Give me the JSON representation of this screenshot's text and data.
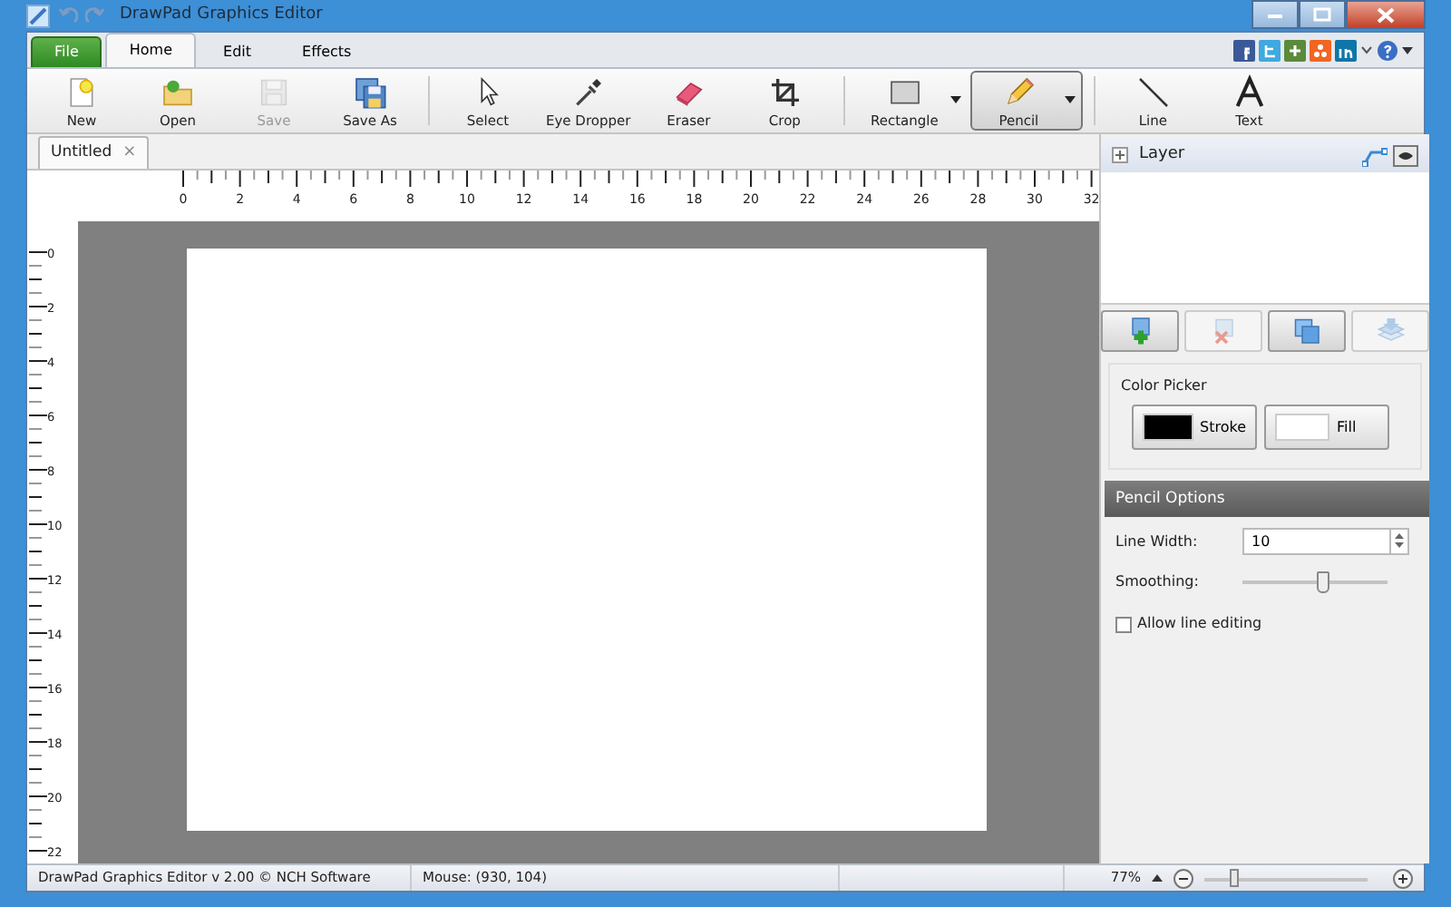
{
  "window": {
    "title": "DrawPad Graphics Editor"
  },
  "menu_tabs": [
    {
      "label": "File",
      "kind": "file",
      "selected": false
    },
    {
      "label": "Home",
      "kind": "tab",
      "selected": true
    },
    {
      "label": "Edit",
      "kind": "tab",
      "selected": false
    },
    {
      "label": "Effects",
      "kind": "tab",
      "selected": false
    }
  ],
  "toolbar": {
    "groups": [
      [
        {
          "label": "New",
          "kind": "new",
          "disabled": false,
          "selected": false,
          "dropdown": false
        },
        {
          "label": "Open",
          "kind": "open",
          "disabled": false,
          "selected": false,
          "dropdown": false
        },
        {
          "label": "Save",
          "kind": "save",
          "disabled": true,
          "selected": false,
          "dropdown": false
        },
        {
          "label": "Save As",
          "kind": "saveas",
          "disabled": false,
          "selected": false,
          "dropdown": false
        }
      ],
      [
        {
          "label": "Select",
          "kind": "select",
          "disabled": false,
          "selected": false,
          "dropdown": false
        },
        {
          "label": "Eye Dropper",
          "kind": "dropper",
          "disabled": false,
          "selected": false,
          "dropdown": false
        },
        {
          "label": "Eraser",
          "kind": "eraser",
          "disabled": false,
          "selected": false,
          "dropdown": false
        },
        {
          "label": "Crop",
          "kind": "crop",
          "disabled": false,
          "selected": false,
          "dropdown": false
        }
      ],
      [
        {
          "label": "Rectangle",
          "kind": "rectangle",
          "disabled": false,
          "selected": false,
          "dropdown": true
        },
        {
          "label": "Pencil",
          "kind": "pencil",
          "disabled": false,
          "selected": true,
          "dropdown": true
        }
      ],
      [
        {
          "label": "Line",
          "kind": "line",
          "disabled": false,
          "selected": false,
          "dropdown": false
        },
        {
          "label": "Text",
          "kind": "text",
          "disabled": false,
          "selected": false,
          "dropdown": false
        }
      ]
    ]
  },
  "document_tabs": [
    {
      "label": "Untitled",
      "close": "×",
      "selected": true
    }
  ],
  "rulers": {
    "horizontal": [
      "0",
      "2",
      "4",
      "6",
      "8",
      "10",
      "12",
      "14",
      "16",
      "18",
      "20",
      "22",
      "24",
      "26",
      "28",
      "30",
      "32"
    ],
    "vertical": [
      "0",
      "2",
      "4",
      "6",
      "8",
      "10",
      "12",
      "14",
      "16",
      "18",
      "20",
      "22"
    ]
  },
  "layers_panel": {
    "title": "Layer"
  },
  "layer_actions": [
    {
      "kind": "add",
      "disabled": false
    },
    {
      "kind": "delete",
      "disabled": true
    },
    {
      "kind": "duplicate",
      "disabled": false
    },
    {
      "kind": "merge",
      "disabled": true
    }
  ],
  "color_picker": {
    "title": "Color Picker",
    "buttons": [
      {
        "label": "Stroke",
        "color": "#000000"
      },
      {
        "label": "Fill",
        "color": "#ffffff"
      }
    ]
  },
  "options": {
    "title": "Pencil Options",
    "line_width": {
      "label": "Line Width:",
      "value": "10"
    },
    "smoothing": {
      "label": "Smoothing:",
      "level": 0.55
    },
    "allow_line_editing": {
      "label": "Allow line editing",
      "checked": false
    }
  },
  "status_bar": {
    "app": "DrawPad Graphics Editor v 2.00 © NCH Software",
    "mouse": "Mouse: (930, 104)",
    "zoom": "77%",
    "zoom_slider": {
      "level": 0.18
    }
  }
}
